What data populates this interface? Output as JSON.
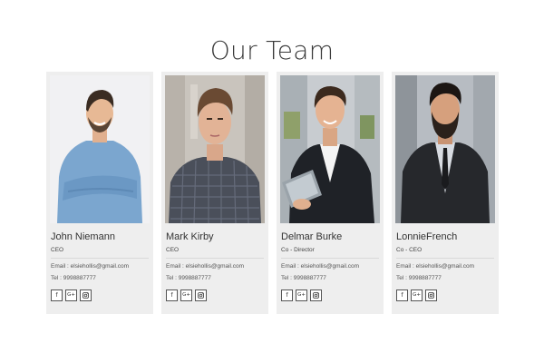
{
  "section": {
    "title": "Our Team"
  },
  "team": [
    {
      "name": "John Niemann",
      "role": "CEO",
      "email": "Email : elsiehollis@gmail.com",
      "tel": "Tel : 9998887777",
      "social": {
        "facebook": "f",
        "google": "G+"
      }
    },
    {
      "name": "Mark Kirby",
      "role": "CEO",
      "email": "Email : elsiehollis@gmail.com",
      "tel": "Tel : 9998887777",
      "social": {
        "facebook": "f",
        "google": "G+"
      }
    },
    {
      "name": "Delmar Burke",
      "role": "Co - Director",
      "email": "Email : elsiehollis@gmail.com",
      "tel": "Tel : 9998887777",
      "social": {
        "facebook": "f",
        "google": "G+"
      }
    },
    {
      "name": "LonnieFrench",
      "role": "Co - CEO",
      "email": "Email : elsiehollis@gmail.com",
      "tel": "Tel : 9998887777",
      "social": {
        "facebook": "f",
        "google": "G+"
      }
    }
  ],
  "colors": {
    "card_background": "#eeeeee",
    "title_text": "#3a3a3a",
    "icon_border": "#555555"
  },
  "icons": [
    "facebook-icon",
    "google-plus-icon",
    "instagram-icon"
  ]
}
